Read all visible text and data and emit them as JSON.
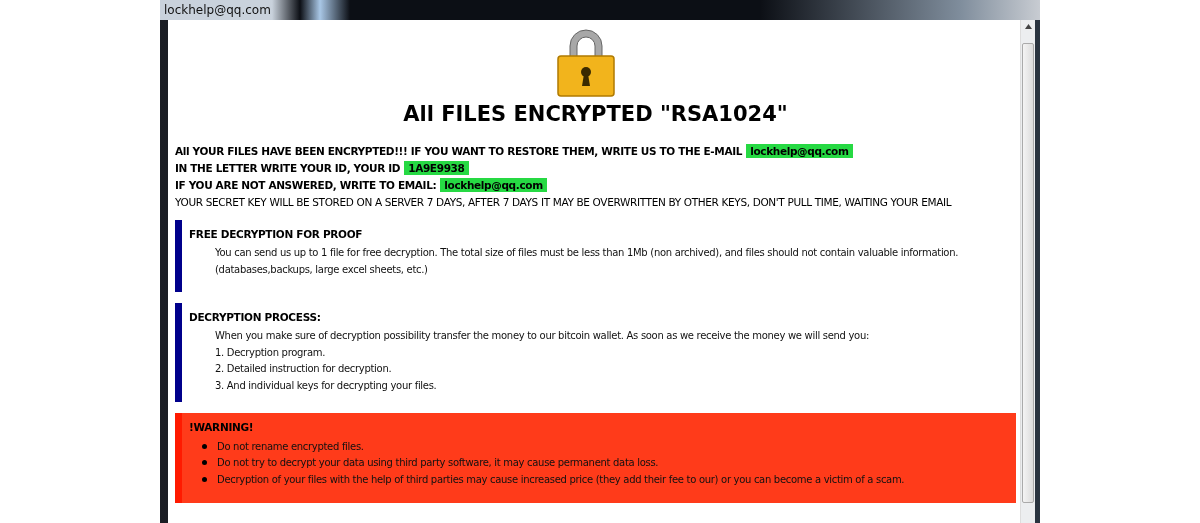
{
  "window": {
    "title": "lockhelp@qq.com"
  },
  "heading": "All FILES ENCRYPTED \"RSA1024\"",
  "notice_lines": [
    {
      "kind": "bold",
      "text": "All YOUR FILES HAVE BEEN ENCRYPTED!!! IF YOU WANT TO RESTORE THEM, WRITE US TO THE E-MAIL",
      "highlight": "lockhelp@qq.com"
    },
    {
      "kind": "bold",
      "text": "IN THE LETTER WRITE YOUR ID, YOUR ID",
      "highlight": "1A9E9938"
    },
    {
      "kind": "bold",
      "text": "IF YOU ARE NOT ANSWERED, WRITE TO EMAIL:",
      "highlight": "lockhelp@qq.com"
    },
    {
      "kind": "plain",
      "text": "YOUR SECRET KEY WILL BE STORED ON A SERVER 7 DAYS, AFTER 7 DAYS IT MAY BE OVERWRITTEN BY OTHER KEYS, DON'T PULL TIME, WAITING YOUR EMAIL"
    }
  ],
  "sections": [
    {
      "kind": "info",
      "title": "FREE DECRYPTION FOR PROOF",
      "lines": [
        "You can send us up to 1 file for free decryption. The total size of files must be less than 1Mb (non archived), and files should not contain valuable information. (databases,backups, large excel sheets, etc.)"
      ]
    },
    {
      "kind": "info",
      "title": "DECRYPTION PROCESS:",
      "lines": [
        "When you make sure of decryption possibility transfer the money to our bitcoin wallet. As soon as we receive the money we will send you:",
        "1. Decryption program.",
        "2. Detailed instruction for decryption.",
        "3. And individual keys for decrypting your files."
      ]
    },
    {
      "kind": "warning",
      "title": "!WARNING!",
      "bullets": [
        "Do not rename encrypted files.",
        "Do not try to decrypt your data using third party software, it may cause permanent data loss.",
        "Decryption of your files with the help of third parties may cause increased price (they add their fee to our) or you can become a victim of a scam."
      ]
    }
  ]
}
